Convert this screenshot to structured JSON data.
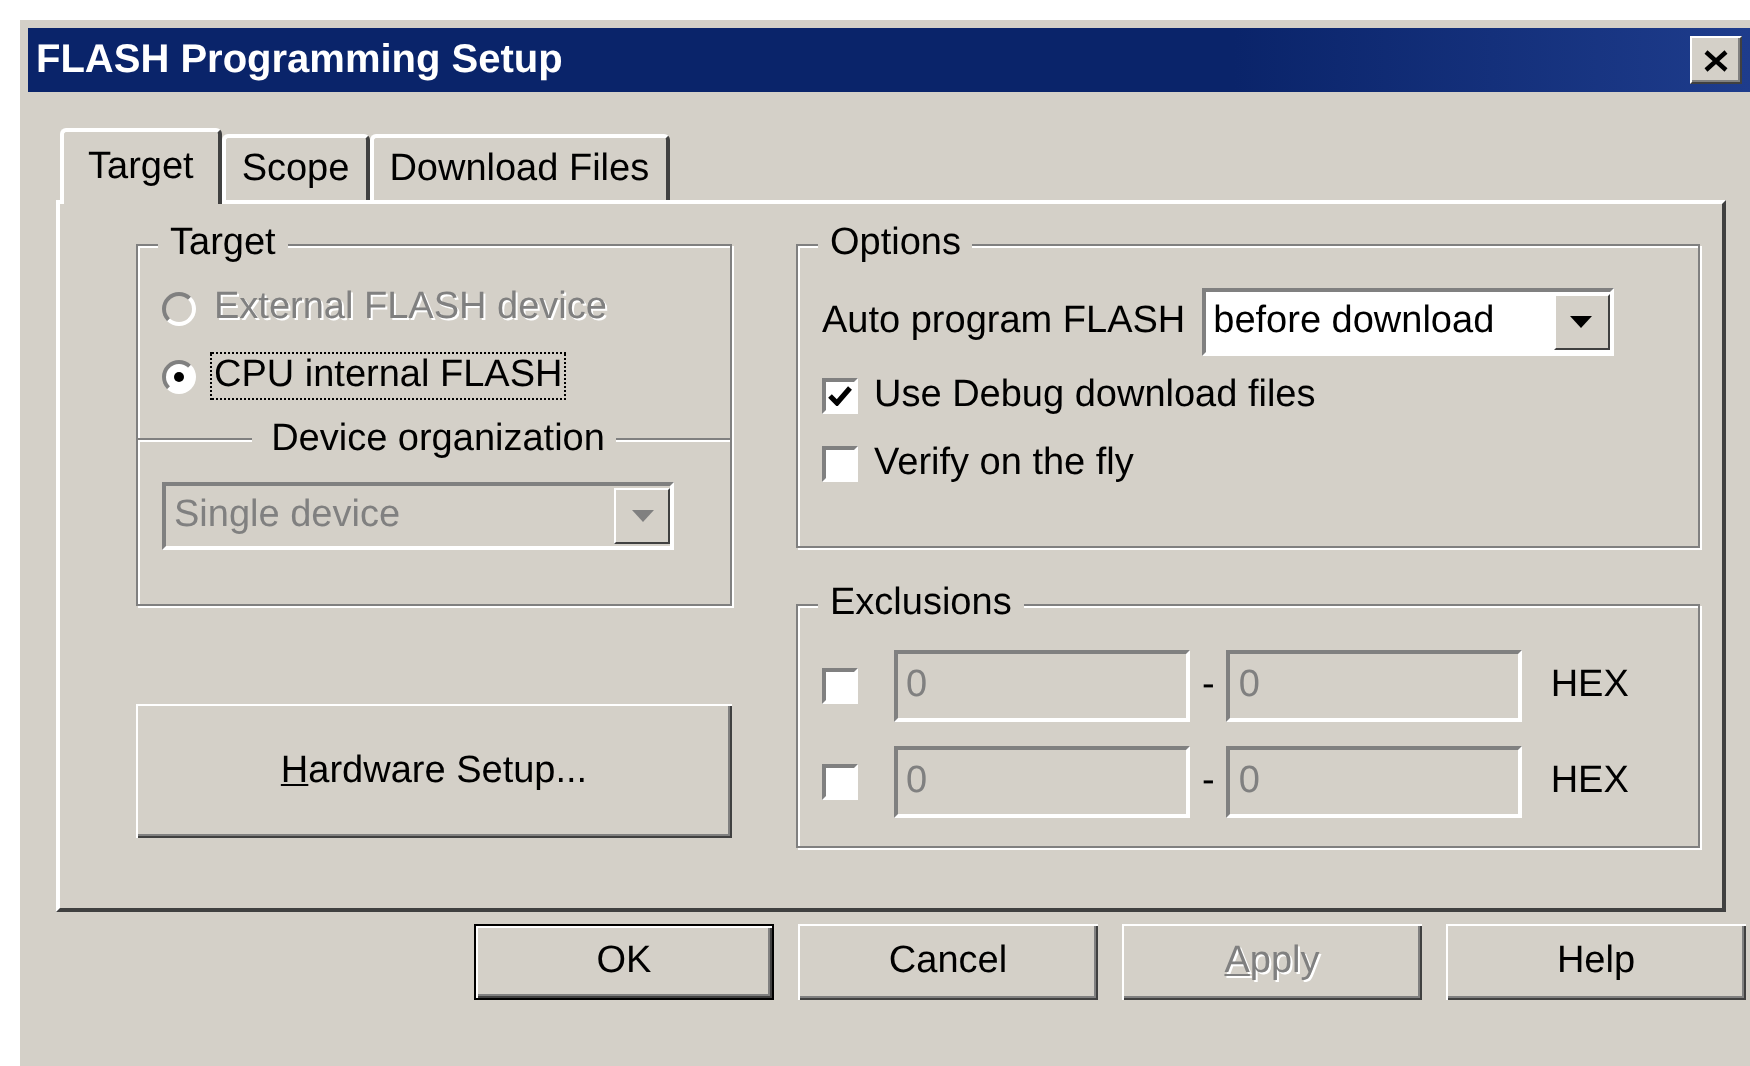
{
  "window": {
    "title": "FLASH Programming Setup"
  },
  "tabs": [
    {
      "label": "Target",
      "selected": true
    },
    {
      "label": "Scope",
      "selected": false
    },
    {
      "label": "Download Files",
      "selected": false
    }
  ],
  "target_group": {
    "legend": "Target",
    "radios": [
      {
        "label": "External FLASH device",
        "selected": false,
        "disabled": true,
        "focused": false
      },
      {
        "label": "CPU internal FLASH",
        "selected": true,
        "disabled": false,
        "focused": true
      }
    ],
    "organization_legend": "Device organization",
    "organization_select": {
      "value": "Single device",
      "disabled": true
    }
  },
  "hardware_button": {
    "label": "Hardware Setup...",
    "underline_first": true
  },
  "options": {
    "legend": "Options",
    "auto_program": {
      "label": "Auto program FLASH",
      "value": "before download"
    },
    "checkboxes": [
      {
        "label": "Use Debug download files",
        "checked": true
      },
      {
        "label": "Verify on the fly",
        "checked": false
      }
    ]
  },
  "exclusions": {
    "legend": "Exclusions",
    "rows": [
      {
        "checked": false,
        "from": "0",
        "separator": "-",
        "to": "0",
        "unit": "HEX",
        "disabled": true
      },
      {
        "checked": false,
        "from": "0",
        "separator": "-",
        "to": "0",
        "unit": "HEX",
        "disabled": true
      }
    ]
  },
  "buttons": [
    {
      "label": "OK",
      "disabled": false,
      "default": true,
      "underline_first": false
    },
    {
      "label": "Cancel",
      "disabled": false,
      "default": false,
      "underline_first": false
    },
    {
      "label": "Apply",
      "disabled": true,
      "default": false,
      "underline_first": true
    },
    {
      "label": "Help",
      "disabled": false,
      "default": false,
      "underline_first": false
    }
  ]
}
